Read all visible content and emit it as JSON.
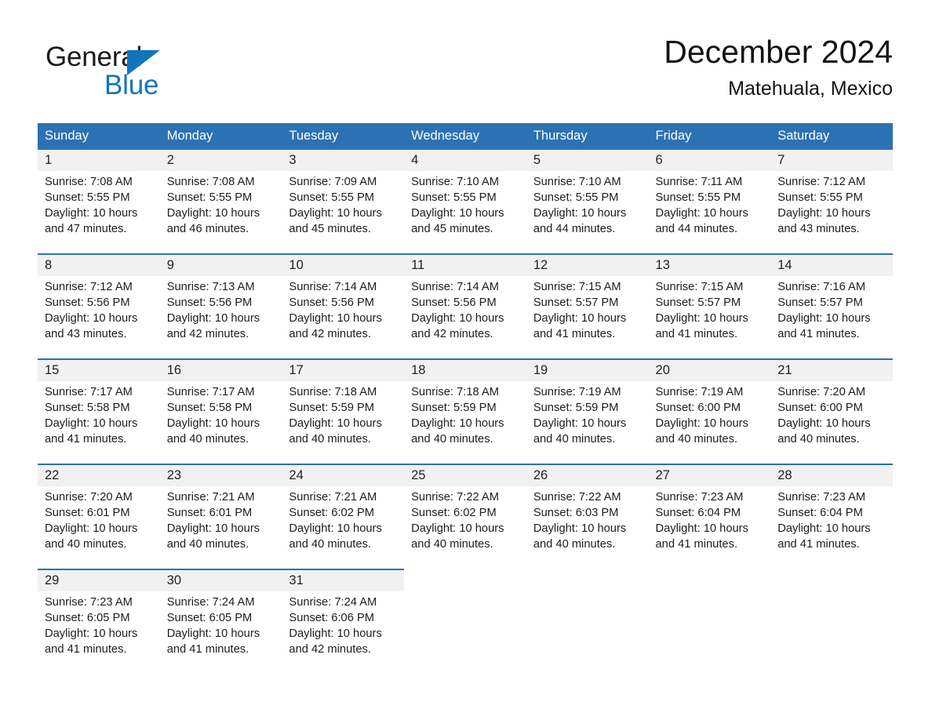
{
  "brand": {
    "name_part1": "General",
    "name_part2": "Blue",
    "triangle_color": "#1175bc"
  },
  "header": {
    "title": "December 2024",
    "location": "Matehuala, Mexico",
    "header_bg_color": "#2c71b3",
    "daynum_bg_color": "#f1f1f1"
  },
  "weekday_headers": [
    "Sunday",
    "Monday",
    "Tuesday",
    "Wednesday",
    "Thursday",
    "Friday",
    "Saturday"
  ],
  "weeks": [
    {
      "days": [
        {
          "num": "1",
          "sunrise": "Sunrise: 7:08 AM",
          "sunset": "Sunset: 5:55 PM",
          "daylight_l1": "Daylight: 10 hours",
          "daylight_l2": "and 47 minutes."
        },
        {
          "num": "2",
          "sunrise": "Sunrise: 7:08 AM",
          "sunset": "Sunset: 5:55 PM",
          "daylight_l1": "Daylight: 10 hours",
          "daylight_l2": "and 46 minutes."
        },
        {
          "num": "3",
          "sunrise": "Sunrise: 7:09 AM",
          "sunset": "Sunset: 5:55 PM",
          "daylight_l1": "Daylight: 10 hours",
          "daylight_l2": "and 45 minutes."
        },
        {
          "num": "4",
          "sunrise": "Sunrise: 7:10 AM",
          "sunset": "Sunset: 5:55 PM",
          "daylight_l1": "Daylight: 10 hours",
          "daylight_l2": "and 45 minutes."
        },
        {
          "num": "5",
          "sunrise": "Sunrise: 7:10 AM",
          "sunset": "Sunset: 5:55 PM",
          "daylight_l1": "Daylight: 10 hours",
          "daylight_l2": "and 44 minutes."
        },
        {
          "num": "6",
          "sunrise": "Sunrise: 7:11 AM",
          "sunset": "Sunset: 5:55 PM",
          "daylight_l1": "Daylight: 10 hours",
          "daylight_l2": "and 44 minutes."
        },
        {
          "num": "7",
          "sunrise": "Sunrise: 7:12 AM",
          "sunset": "Sunset: 5:55 PM",
          "daylight_l1": "Daylight: 10 hours",
          "daylight_l2": "and 43 minutes."
        }
      ]
    },
    {
      "days": [
        {
          "num": "8",
          "sunrise": "Sunrise: 7:12 AM",
          "sunset": "Sunset: 5:56 PM",
          "daylight_l1": "Daylight: 10 hours",
          "daylight_l2": "and 43 minutes."
        },
        {
          "num": "9",
          "sunrise": "Sunrise: 7:13 AM",
          "sunset": "Sunset: 5:56 PM",
          "daylight_l1": "Daylight: 10 hours",
          "daylight_l2": "and 42 minutes."
        },
        {
          "num": "10",
          "sunrise": "Sunrise: 7:14 AM",
          "sunset": "Sunset: 5:56 PM",
          "daylight_l1": "Daylight: 10 hours",
          "daylight_l2": "and 42 minutes."
        },
        {
          "num": "11",
          "sunrise": "Sunrise: 7:14 AM",
          "sunset": "Sunset: 5:56 PM",
          "daylight_l1": "Daylight: 10 hours",
          "daylight_l2": "and 42 minutes."
        },
        {
          "num": "12",
          "sunrise": "Sunrise: 7:15 AM",
          "sunset": "Sunset: 5:57 PM",
          "daylight_l1": "Daylight: 10 hours",
          "daylight_l2": "and 41 minutes."
        },
        {
          "num": "13",
          "sunrise": "Sunrise: 7:15 AM",
          "sunset": "Sunset: 5:57 PM",
          "daylight_l1": "Daylight: 10 hours",
          "daylight_l2": "and 41 minutes."
        },
        {
          "num": "14",
          "sunrise": "Sunrise: 7:16 AM",
          "sunset": "Sunset: 5:57 PM",
          "daylight_l1": "Daylight: 10 hours",
          "daylight_l2": "and 41 minutes."
        }
      ]
    },
    {
      "days": [
        {
          "num": "15",
          "sunrise": "Sunrise: 7:17 AM",
          "sunset": "Sunset: 5:58 PM",
          "daylight_l1": "Daylight: 10 hours",
          "daylight_l2": "and 41 minutes."
        },
        {
          "num": "16",
          "sunrise": "Sunrise: 7:17 AM",
          "sunset": "Sunset: 5:58 PM",
          "daylight_l1": "Daylight: 10 hours",
          "daylight_l2": "and 40 minutes."
        },
        {
          "num": "17",
          "sunrise": "Sunrise: 7:18 AM",
          "sunset": "Sunset: 5:59 PM",
          "daylight_l1": "Daylight: 10 hours",
          "daylight_l2": "and 40 minutes."
        },
        {
          "num": "18",
          "sunrise": "Sunrise: 7:18 AM",
          "sunset": "Sunset: 5:59 PM",
          "daylight_l1": "Daylight: 10 hours",
          "daylight_l2": "and 40 minutes."
        },
        {
          "num": "19",
          "sunrise": "Sunrise: 7:19 AM",
          "sunset": "Sunset: 5:59 PM",
          "daylight_l1": "Daylight: 10 hours",
          "daylight_l2": "and 40 minutes."
        },
        {
          "num": "20",
          "sunrise": "Sunrise: 7:19 AM",
          "sunset": "Sunset: 6:00 PM",
          "daylight_l1": "Daylight: 10 hours",
          "daylight_l2": "and 40 minutes."
        },
        {
          "num": "21",
          "sunrise": "Sunrise: 7:20 AM",
          "sunset": "Sunset: 6:00 PM",
          "daylight_l1": "Daylight: 10 hours",
          "daylight_l2": "and 40 minutes."
        }
      ]
    },
    {
      "days": [
        {
          "num": "22",
          "sunrise": "Sunrise: 7:20 AM",
          "sunset": "Sunset: 6:01 PM",
          "daylight_l1": "Daylight: 10 hours",
          "daylight_l2": "and 40 minutes."
        },
        {
          "num": "23",
          "sunrise": "Sunrise: 7:21 AM",
          "sunset": "Sunset: 6:01 PM",
          "daylight_l1": "Daylight: 10 hours",
          "daylight_l2": "and 40 minutes."
        },
        {
          "num": "24",
          "sunrise": "Sunrise: 7:21 AM",
          "sunset": "Sunset: 6:02 PM",
          "daylight_l1": "Daylight: 10 hours",
          "daylight_l2": "and 40 minutes."
        },
        {
          "num": "25",
          "sunrise": "Sunrise: 7:22 AM",
          "sunset": "Sunset: 6:02 PM",
          "daylight_l1": "Daylight: 10 hours",
          "daylight_l2": "and 40 minutes."
        },
        {
          "num": "26",
          "sunrise": "Sunrise: 7:22 AM",
          "sunset": "Sunset: 6:03 PM",
          "daylight_l1": "Daylight: 10 hours",
          "daylight_l2": "and 40 minutes."
        },
        {
          "num": "27",
          "sunrise": "Sunrise: 7:23 AM",
          "sunset": "Sunset: 6:04 PM",
          "daylight_l1": "Daylight: 10 hours",
          "daylight_l2": "and 41 minutes."
        },
        {
          "num": "28",
          "sunrise": "Sunrise: 7:23 AM",
          "sunset": "Sunset: 6:04 PM",
          "daylight_l1": "Daylight: 10 hours",
          "daylight_l2": "and 41 minutes."
        }
      ]
    },
    {
      "days": [
        {
          "num": "29",
          "sunrise": "Sunrise: 7:23 AM",
          "sunset": "Sunset: 6:05 PM",
          "daylight_l1": "Daylight: 10 hours",
          "daylight_l2": "and 41 minutes."
        },
        {
          "num": "30",
          "sunrise": "Sunrise: 7:24 AM",
          "sunset": "Sunset: 6:05 PM",
          "daylight_l1": "Daylight: 10 hours",
          "daylight_l2": "and 41 minutes."
        },
        {
          "num": "31",
          "sunrise": "Sunrise: 7:24 AM",
          "sunset": "Sunset: 6:06 PM",
          "daylight_l1": "Daylight: 10 hours",
          "daylight_l2": "and 42 minutes."
        },
        {
          "num": "",
          "sunrise": "",
          "sunset": "",
          "daylight_l1": "",
          "daylight_l2": "",
          "empty": true
        },
        {
          "num": "",
          "sunrise": "",
          "sunset": "",
          "daylight_l1": "",
          "daylight_l2": "",
          "empty": true
        },
        {
          "num": "",
          "sunrise": "",
          "sunset": "",
          "daylight_l1": "",
          "daylight_l2": "",
          "empty": true
        },
        {
          "num": "",
          "sunrise": "",
          "sunset": "",
          "daylight_l1": "",
          "daylight_l2": "",
          "empty": true
        }
      ]
    }
  ]
}
